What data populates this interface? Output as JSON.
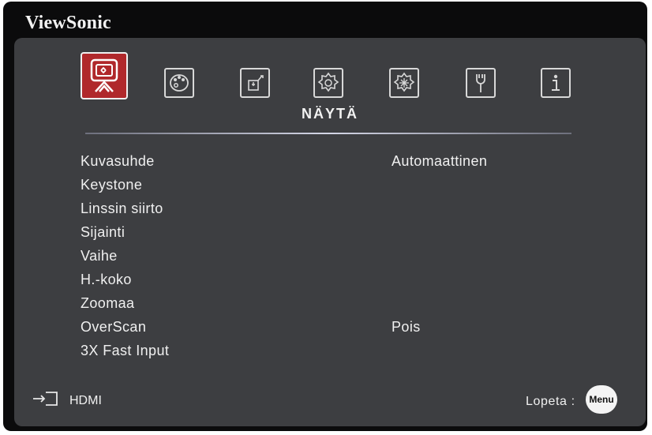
{
  "brand": {
    "name": "ViewSonic"
  },
  "tabs": [
    {
      "icon": "display-icon",
      "active": true
    },
    {
      "icon": "picture-palette-icon",
      "active": false
    },
    {
      "icon": "power-management-icon",
      "active": false
    },
    {
      "icon": "basic-settings-gear-icon",
      "active": false
    },
    {
      "icon": "advanced-settings-gear-icon",
      "active": false
    },
    {
      "icon": "system-wrench-icon",
      "active": false
    },
    {
      "icon": "information-icon",
      "active": false
    }
  ],
  "section": {
    "title": "NÄYTÄ"
  },
  "menu": {
    "items": [
      {
        "label": "Kuvasuhde",
        "value": "Automaattinen"
      },
      {
        "label": "Keystone",
        "value": ""
      },
      {
        "label": "Linssin siirto",
        "value": ""
      },
      {
        "label": "Sijainti",
        "value": ""
      },
      {
        "label": "Vaihe",
        "value": ""
      },
      {
        "label": "H.-koko",
        "value": ""
      },
      {
        "label": "Zoomaa",
        "value": ""
      },
      {
        "label": "OverScan",
        "value": "Pois"
      },
      {
        "label": "3X Fast Input",
        "value": ""
      }
    ]
  },
  "footer": {
    "source_icon": "input-source-icon",
    "source": "HDMI",
    "exit_label": "Lopeta :",
    "menu_button": "Menu"
  },
  "colors": {
    "frame": "#0b0b0c",
    "panel": "#3d3e41",
    "active_tab": "#b0282b",
    "text": "#f0f0f0"
  }
}
